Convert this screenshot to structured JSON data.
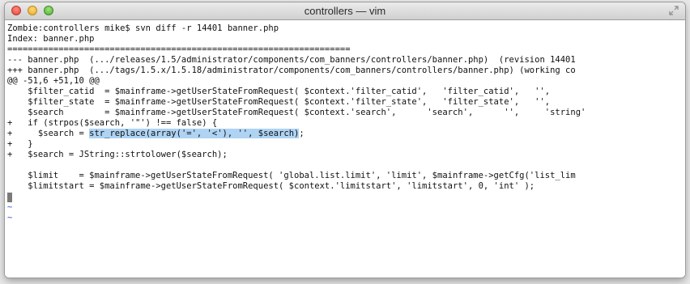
{
  "window": {
    "title": "controllers — vim"
  },
  "terminal": {
    "lines": [
      "Zombie:controllers mike$ svn diff -r 14401 banner.php",
      "Index: banner.php",
      "===================================================================",
      "--- banner.php  (.../releases/1.5/administrator/components/com_banners/controllers/banner.php)  (revision 14401",
      "+++ banner.php  (.../tags/1.5.x/1.5.18/administrator/components/com_banners/controllers/banner.php) (working co",
      "@@ -51,6 +51,10 @@",
      "    $filter_catid  = $mainframe->getUserStateFromRequest( $context.'filter_catid',   'filter_catid',   '',",
      "    $filter_state  = $mainframe->getUserStateFromRequest( $context.'filter_state',   'filter_state',   '',",
      "    $search        = $mainframe->getUserStateFromRequest( $context.'search',      'search',      '',     'string'",
      "+   if (strpos($search, '\"') !== false) {",
      "+     $search = ",
      "+   }",
      "+   $search = JString::strtolower($search);",
      "",
      "    $limit    = $mainframe->getUserStateFromRequest( 'global.list.limit', 'limit', $mainframe->getCfg('list_lim",
      "    $limitstart = $mainframe->getUserStateFromRequest( $context.'limitstart', 'limitstart', 0, 'int' );",
      "",
      "~",
      "~"
    ],
    "selected_text": "str_replace(array('=', '<'), '', $search)",
    "selected_suffix": ";"
  }
}
